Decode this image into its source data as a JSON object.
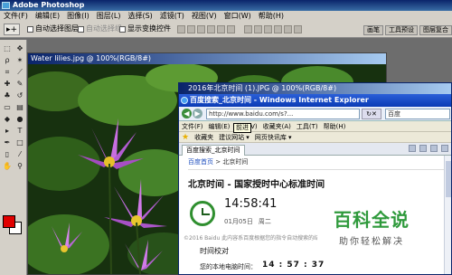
{
  "photoshop": {
    "title": "Adobe Photoshop",
    "menu": [
      "文件(F)",
      "编辑(E)",
      "图像(I)",
      "图层(L)",
      "选择(S)",
      "滤镜(T)",
      "视图(V)",
      "窗口(W)",
      "帮助(H)"
    ],
    "options": {
      "auto_select_layer": "自动选择图层",
      "auto_select_group": "自动选择组",
      "show_transform_controls": "显示变换控件"
    },
    "palette_tabs": [
      "画笔",
      "工具预设",
      "图层复合"
    ],
    "colors": {
      "foreground": "#e00000",
      "background": "#ffffff"
    }
  },
  "document": {
    "title": "Water lilies.jpg @ 100%(RGB/8#)"
  },
  "ie_document": {
    "title": "2016年北京时间 (1).JPG @ 100%(RGB/8#)"
  },
  "browser": {
    "title": "百度搜索_北京时间 - Windows Internet Explorer",
    "url": "http://www.baidu.com/s?...",
    "search_placeholder": "百度",
    "tooltip": "前进",
    "menu": [
      "文件(F)",
      "编辑(E)",
      "查看(V)",
      "收藏夹(A)",
      "工具(T)",
      "帮助(H)"
    ],
    "favorites_label": "收藏夹",
    "fav_links": [
      "建议网站 ▾",
      "网页快讯库 ▾"
    ],
    "tab_label": "百度搜索_北京时间"
  },
  "page": {
    "breadcrumb_home": "百度首页",
    "breadcrumb_sep": ">",
    "breadcrumb_current": "北京时间",
    "title": "北京时间 - 国家授时中心标准时间",
    "time": "14:58:41",
    "date": "01月05日",
    "weekday": "周二",
    "disclaimer": "©2016 Baidu 此内容系百度根据您的指令自动搜索的结",
    "section": "时间校对",
    "local_time_label": "您的本地电脑时间：",
    "local_time_value": "14 : 57 : 37"
  },
  "watermark": {
    "main": "百科全说",
    "sub": "助你轻松解决"
  }
}
